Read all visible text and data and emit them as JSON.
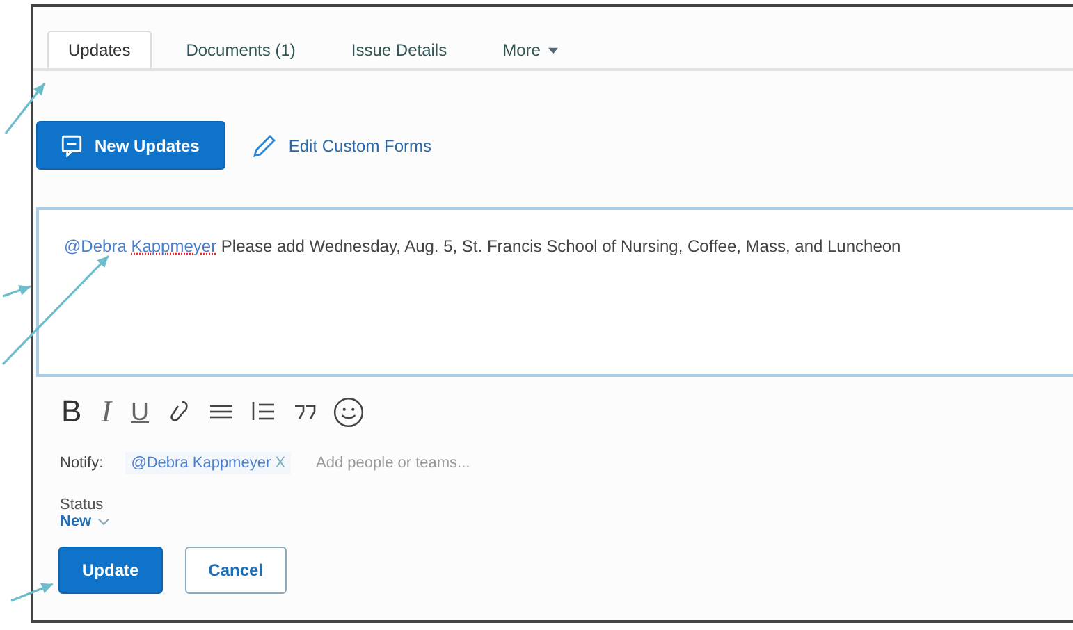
{
  "tabs": [
    {
      "label": "Updates",
      "selected": true
    },
    {
      "label": "Documents (1)",
      "selected": false
    },
    {
      "label": "Issue Details",
      "selected": false
    },
    {
      "label": "More",
      "selected": false,
      "kind": "menu"
    }
  ],
  "actions": [
    {
      "kind": "primary",
      "label": "New Updates"
    },
    {
      "kind": "link",
      "label": "Edit Custom Forms"
    }
  ],
  "editor": {
    "mention_first": "@Debra",
    "mention_last": "Kappmeyer",
    "text": "Please add Wednesday, Aug. 5, St. Francis School of Nursing, Coffee, Mass, and Luncheon"
  },
  "toolbar": [
    {
      "kind": "bold",
      "label": "B"
    },
    {
      "kind": "italic",
      "label": "I"
    },
    {
      "kind": "underline",
      "label": "U"
    },
    {
      "kind": "link"
    },
    {
      "kind": "bullets"
    },
    {
      "kind": "numbers"
    },
    {
      "kind": "quote"
    },
    {
      "kind": "emoji"
    }
  ],
  "notify": {
    "label": "Notify:",
    "chips": [
      "@Debra Kappmeyer"
    ],
    "remove": "X",
    "placeholder": "Add people or teams..."
  },
  "status": {
    "label": "Status",
    "value": "New"
  },
  "buttons": [
    {
      "kind": "primary",
      "label": "Update"
    },
    {
      "kind": "secondary",
      "label": "Cancel"
    }
  ]
}
